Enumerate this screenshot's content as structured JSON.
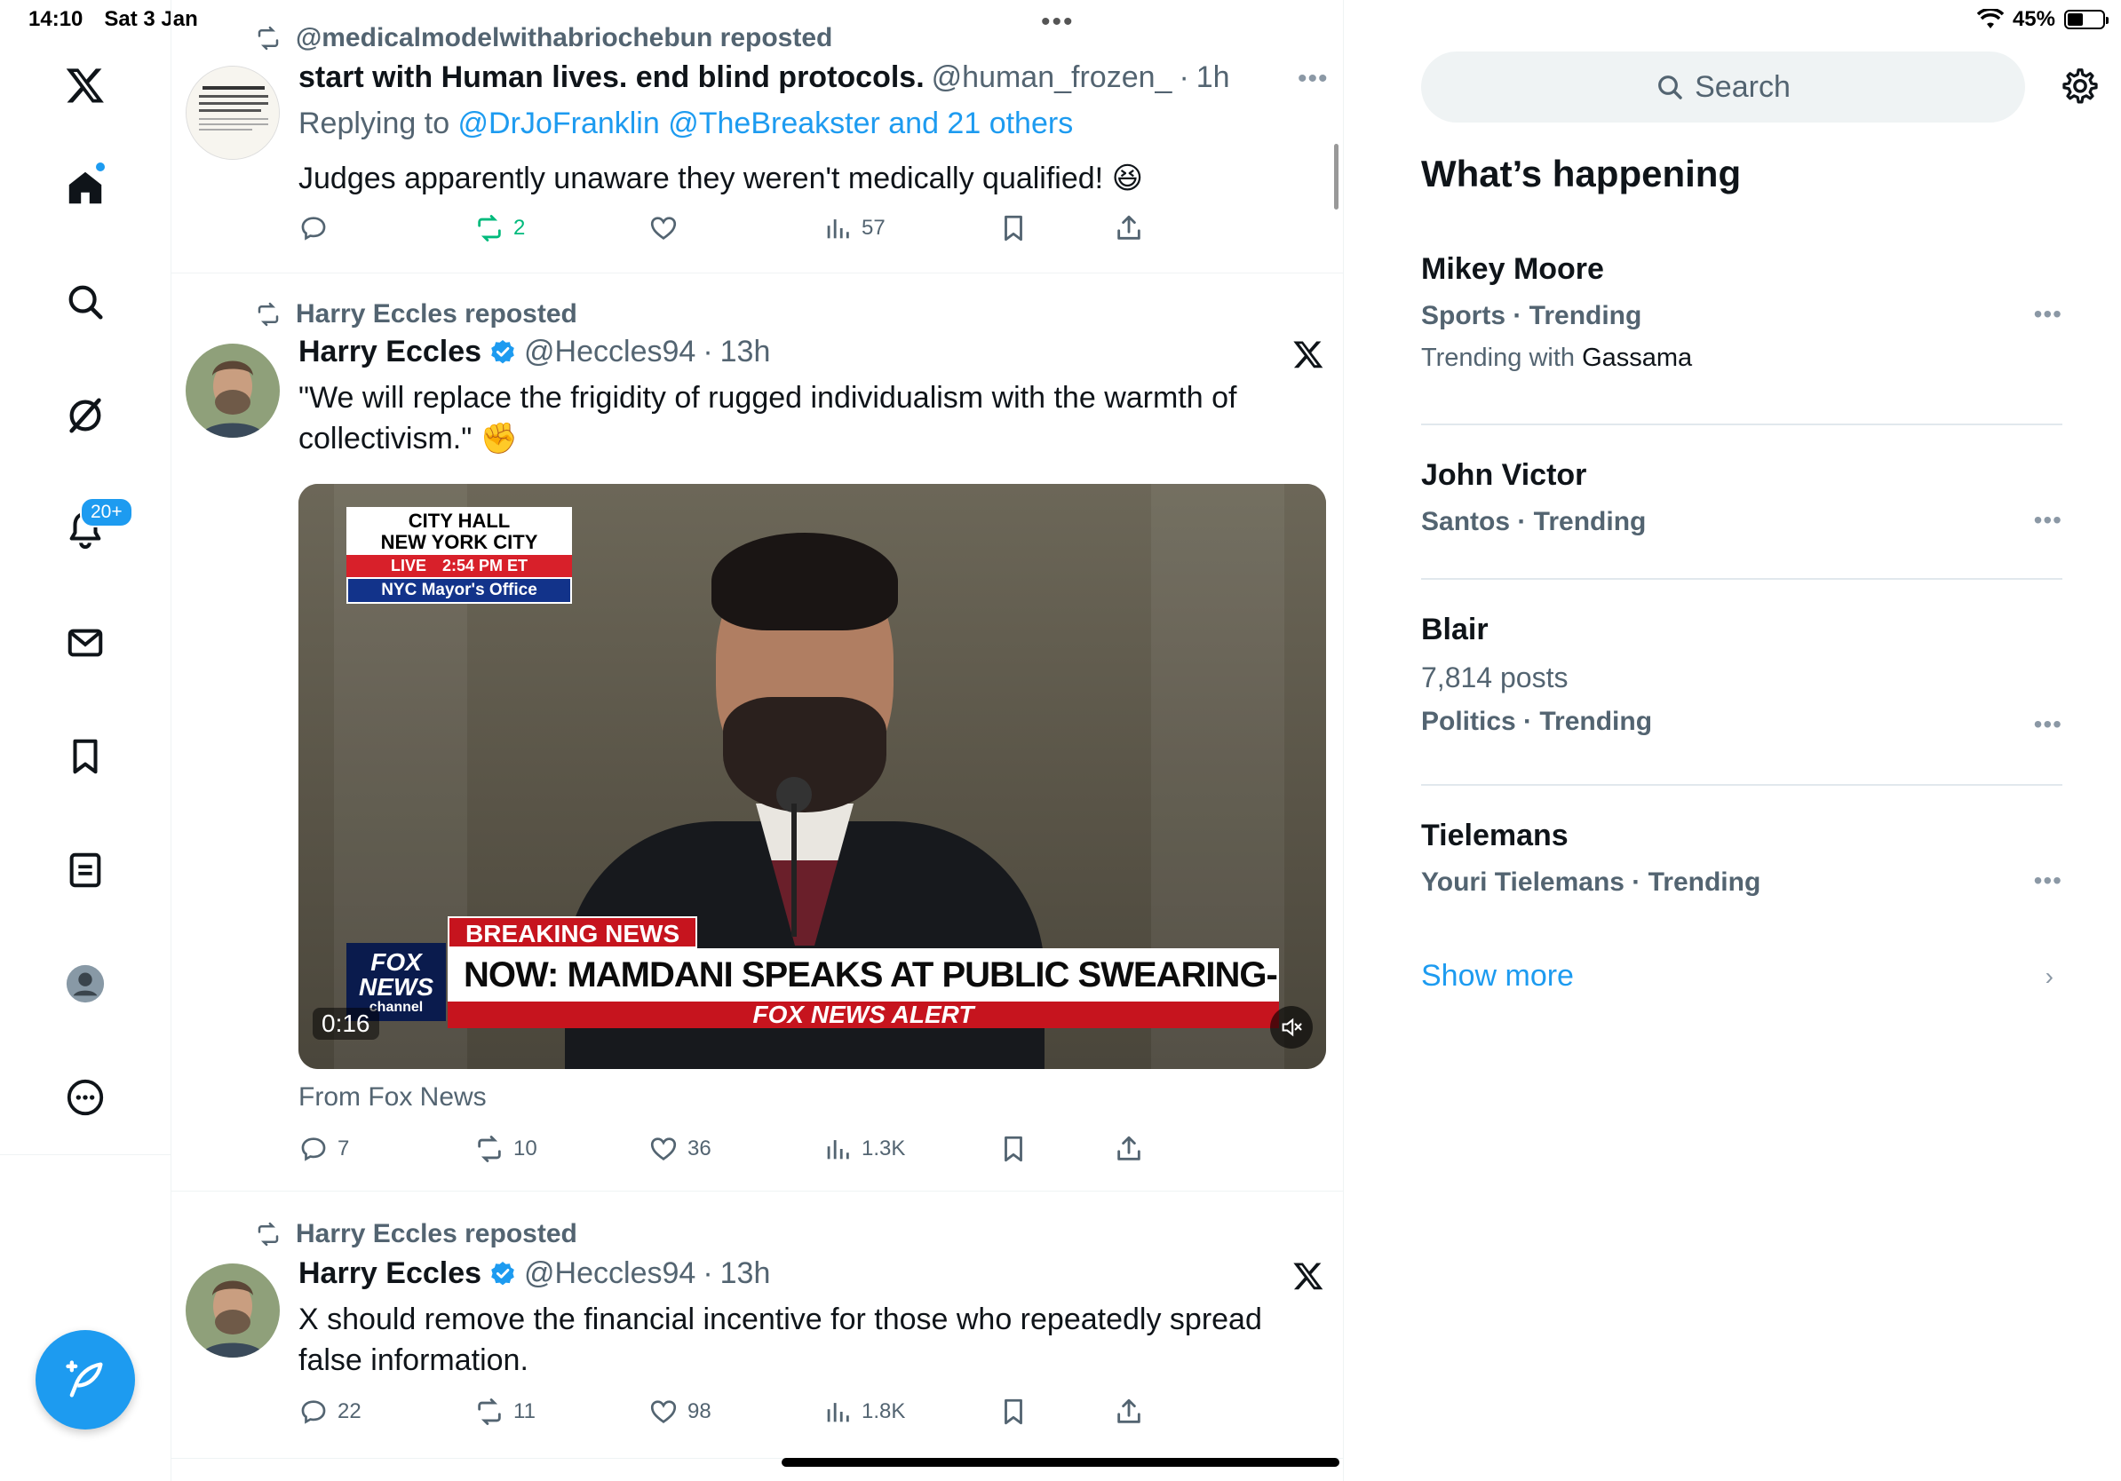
{
  "status_bar": {
    "time": "14:10",
    "date": "Sat 3 Jan",
    "battery": "45%",
    "battery_level": 0.45
  },
  "nav": {
    "items": [
      "x-logo",
      "home",
      "search",
      "grok",
      "notifications",
      "messages",
      "bookmarks",
      "lists",
      "profile",
      "more"
    ],
    "notifications_badge": "20+"
  },
  "posts": [
    {
      "repost_by": "@medicalmodelwithabriochebun reposted",
      "name": "start with Human lives. end blind protocols.",
      "handle": "@human_frozen_",
      "time": "1h",
      "reply_prefix": "Replying to ",
      "reply_targets": "@DrJoFranklin @TheBreakster and 21 others",
      "text": "Judges apparently unaware they weren't medically qualified! 😆",
      "reposts": "2",
      "views": "57"
    },
    {
      "repost_by": "Harry Eccles reposted",
      "name": "Harry Eccles",
      "handle": "@Heccles94",
      "time": "13h",
      "text": "\"We will replace the frigidity of rugged individualism with the warmth of collectivism.\" ✊",
      "video": {
        "bug_line1": "CITY HALL",
        "bug_line2": "NEW YORK CITY",
        "bug_live": "LIVE",
        "bug_time": "2:54 PM ET",
        "bug_office": "NYC Mayor's Office",
        "breaking": "BREAKING NEWS",
        "headline": "NOW: MAMDANI SPEAKS AT PUBLIC SWEARING-IN CEREMONY",
        "alert": "FOX NEWS ALERT",
        "logo_line1": "FOX",
        "logo_line2": "NEWS",
        "logo_line3": "channel",
        "timestamp": "0:16"
      },
      "source": "From Fox News",
      "replies": "7",
      "reposts": "10",
      "likes": "36",
      "views": "1.3K"
    },
    {
      "repost_by": "Harry Eccles reposted",
      "name": "Harry Eccles",
      "handle": "@Heccles94",
      "time": "13h",
      "text": "X should remove the financial incentive for those who repeatedly spread false information.",
      "replies": "22",
      "reposts": "11",
      "likes": "98",
      "views": "1.8K"
    }
  ],
  "right": {
    "search_placeholder": "Search",
    "heading": "What’s happening",
    "trends": [
      {
        "title": "Mikey Moore",
        "meta": "Sports · Trending",
        "with_prefix": "Trending with ",
        "with_name": "Gassama"
      },
      {
        "title": "John Victor",
        "meta": "Santos · Trending"
      },
      {
        "title": "Blair",
        "count": "7,814 posts",
        "meta": "Politics · Trending"
      },
      {
        "title": "Tielemans",
        "meta": "Youri Tielemans · Trending"
      }
    ],
    "show_more": "Show more"
  },
  "colors": {
    "accent": "#1d9bf0",
    "secondary_text": "#536471",
    "repost_green": "#00ba7c"
  }
}
